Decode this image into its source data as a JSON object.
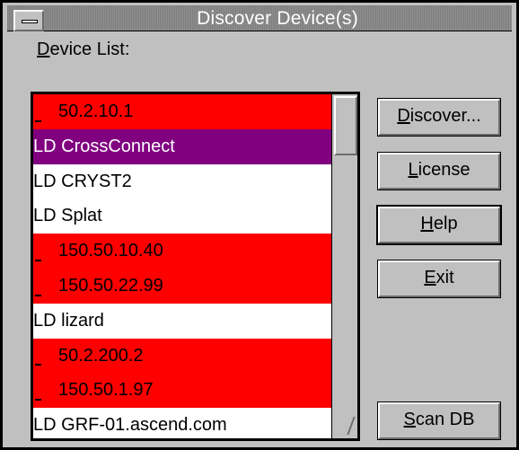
{
  "window": {
    "title": "Discover Device(s)"
  },
  "device_list": {
    "label_underlined": "D",
    "label_rest": "evice List:",
    "items": [
      {
        "prefix": "",
        "name": "50.2.10.1",
        "style": "red"
      },
      {
        "prefix": "LD",
        "name": "CrossConnect",
        "style": "purple"
      },
      {
        "prefix": "LD",
        "name": "CRYST2",
        "style": "white"
      },
      {
        "prefix": "LD",
        "name": "Splat",
        "style": "white"
      },
      {
        "prefix": "",
        "name": "150.50.10.40",
        "style": "red"
      },
      {
        "prefix": "",
        "name": "150.50.22.99",
        "style": "red"
      },
      {
        "prefix": "LD",
        "name": "lizard",
        "style": "white"
      },
      {
        "prefix": "",
        "name": "50.2.200.2",
        "style": "red"
      },
      {
        "prefix": "",
        "name": "150.50.1.97",
        "style": "red"
      },
      {
        "prefix": "LD",
        "name": "GRF-01.ascend.com",
        "style": "white"
      }
    ]
  },
  "buttons": {
    "discover": {
      "underlined": "D",
      "rest": "iscover..."
    },
    "license": {
      "before": "",
      "underlined": "L",
      "rest": "icense"
    },
    "help": {
      "underlined": "H",
      "rest": "elp"
    },
    "exit": {
      "underlined": "E",
      "rest": "xit"
    },
    "scan": {
      "underlined": "S",
      "rest": "can DB"
    }
  },
  "colors": {
    "unlicensed_row": "#ff0000",
    "selected_row": "#800080",
    "licensed_row": "#ffffff"
  }
}
